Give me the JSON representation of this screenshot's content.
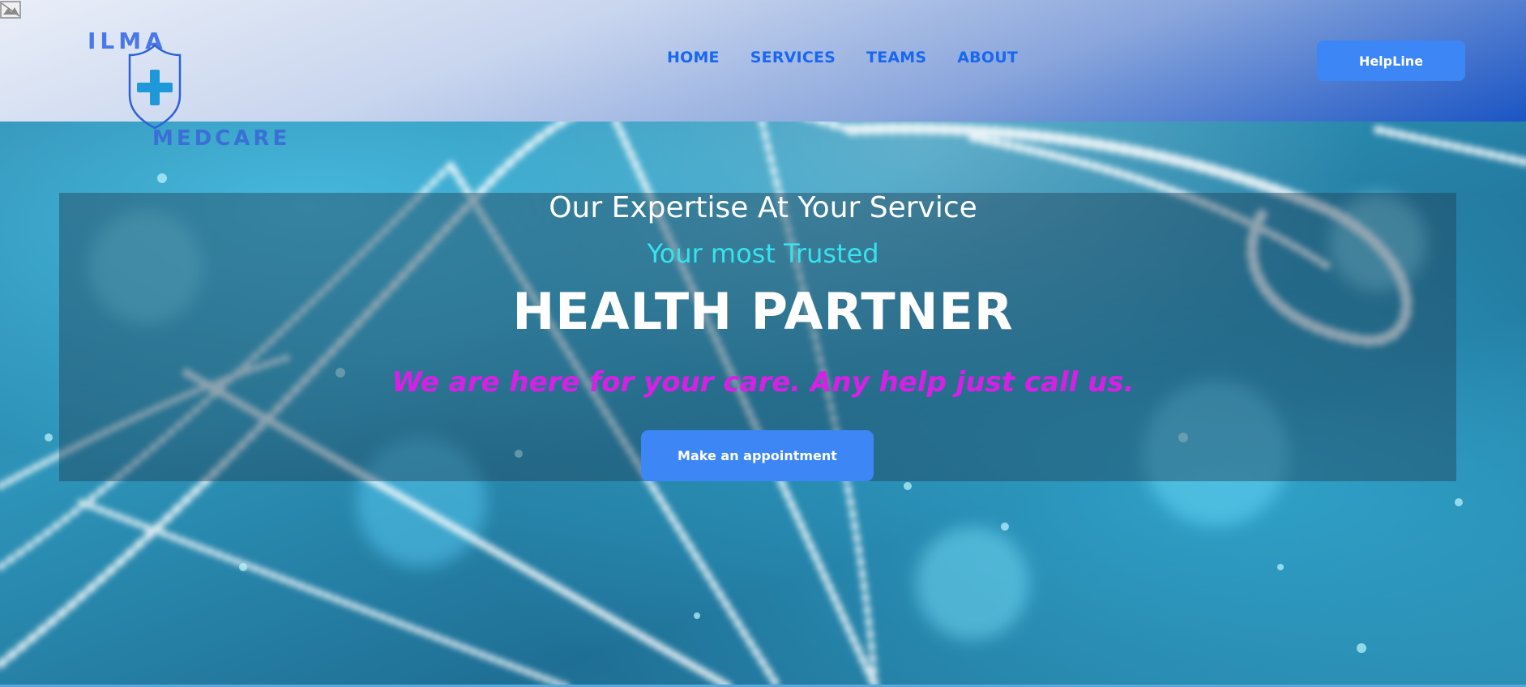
{
  "header": {
    "logo": {
      "top_text": "ILMA",
      "bottom_text": "MEDCARE"
    },
    "nav": [
      {
        "label": "HOME"
      },
      {
        "label": "SERVICES"
      },
      {
        "label": "TEAMS"
      },
      {
        "label": "ABOUT"
      }
    ],
    "helpline_label": "HelpLine"
  },
  "hero": {
    "tagline": "Our Expertise At Your Service",
    "subtitle": "Your most Trusted",
    "headline": "HEALTH PARTNER",
    "care_text": "We are here for your care. Any help just call us.",
    "appointment_label": "Make an appointment"
  },
  "colors": {
    "accent": "#3d86f5",
    "nav_link": "#1967f0",
    "subtitle": "#36e3ee",
    "care_text": "#d81fe6"
  },
  "icons": {
    "logo_mark": "shield-cross-icon",
    "broken_image": "broken-image-icon"
  }
}
